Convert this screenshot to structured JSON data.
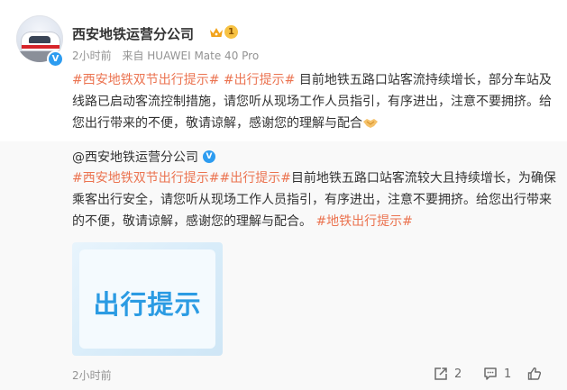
{
  "post": {
    "author": {
      "name": "西安地铁运营分公司",
      "vip_level": "1"
    },
    "meta": {
      "time": "2小时前",
      "source": "来自 HUAWEI Mate 40 Pro"
    },
    "text": {
      "hashtag_1": "#西安地铁双节出行提示#",
      "hashtag_2": "#出行提示#",
      "body": "目前地铁五路口站客流持续增长，部分车站及线路已启动客流控制措施，请您听从现场工作人员指引，有序进出，注意不要拥挤。给您出行带来的不便，敬请谅解，感谢您的理解与配合"
    },
    "emoji": "handshake-emoji",
    "colors": {
      "hashtag": "#eb7350",
      "verify": "#2d9cf0",
      "repost_background": "#f9f9f9"
    }
  },
  "repost": {
    "author": "@西安地铁运营分公司",
    "text": {
      "hashtag_1": "#西安地铁双节出行提示#",
      "hashtag_2": "#出行提示#",
      "body": "目前地铁五路口站客流较大且持续增长，为确保乘客出行安全，请您听从现场工作人员指引，有序进出，注意不要拥挤。给您出行带来的不便，敬请谅解，感谢您的理解与配合。",
      "hashtag_3": "#地铁出行提示#"
    },
    "image_text": "出行提示"
  },
  "footer": {
    "time": "2小时前",
    "share_count": "2",
    "comment_count": "1",
    "like_count": ""
  }
}
